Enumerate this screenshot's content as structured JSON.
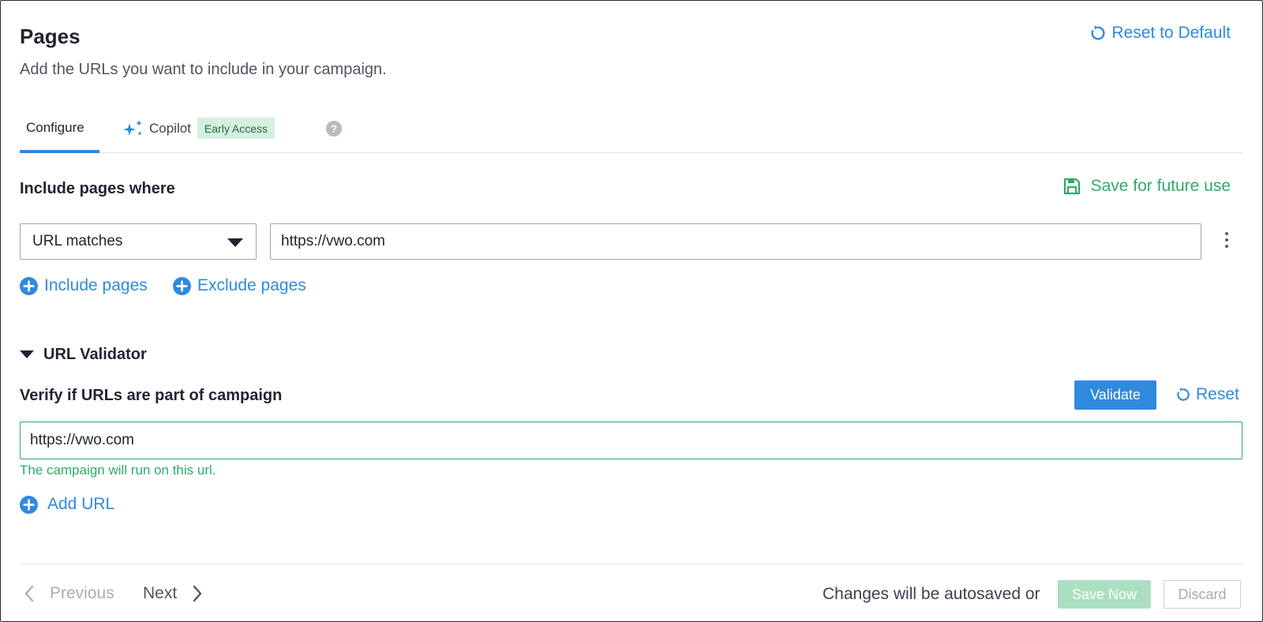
{
  "header": {
    "title": "Pages",
    "subtitle": "Add the URLs you want to include in your campaign.",
    "reset_default_label": "Reset to Default"
  },
  "tabs": {
    "configure_label": "Configure",
    "copilot_label": "Copilot",
    "copilot_badge": "Early Access",
    "help_glyph": "?"
  },
  "include": {
    "title": "Include pages where",
    "save_label": "Save for future use",
    "condition": "URL matches",
    "url_value": "https://vwo.com",
    "include_label": "Include pages",
    "exclude_label": "Exclude pages"
  },
  "validator": {
    "section_label": "URL Validator",
    "verify_label": "Verify if URLs are part of campaign",
    "validate_button": "Validate",
    "reset_label": "Reset",
    "url_value": "https://vwo.com",
    "status_message": "The campaign will run on this url.",
    "add_url_label": "Add URL"
  },
  "footer": {
    "previous_label": "Previous",
    "next_label": "Next",
    "autosave_text": "Changes will be autosaved or",
    "save_now_label": "Save Now",
    "discard_label": "Discard"
  },
  "icons": {
    "reset": "refresh-icon",
    "copilot": "sparkle-icon",
    "help": "help-icon",
    "save": "floppy-disk-icon",
    "dropdown": "caret-down-icon",
    "more": "kebab-menu-icon",
    "add": "plus-circle-icon",
    "collapse": "caret-down-icon",
    "prev": "chevron-left-icon",
    "next": "chevron-right-icon"
  },
  "colors": {
    "primary": "#2f8ade",
    "success": "#2eab67",
    "badge_bg": "#d4f0df",
    "save_now_disabled": "#acdfc2"
  }
}
